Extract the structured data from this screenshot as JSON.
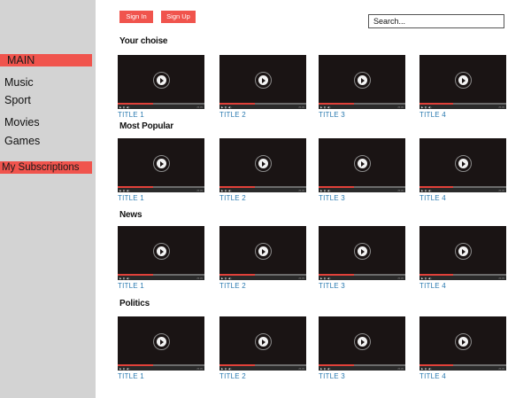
{
  "sidebar": {
    "main": "MAIN",
    "items": [
      "Music",
      "Sport",
      "Movies",
      "Games"
    ],
    "subscriptions": "My Subscriptions"
  },
  "header": {
    "sign_in": "Sign In",
    "sign_up": "Sign Up",
    "search_placeholder": "Search..."
  },
  "sections": [
    {
      "title": "Your choise",
      "videos": [
        "TITLE 1",
        "TITLE 2",
        "TITLE 3",
        "TITLE 4"
      ]
    },
    {
      "title": "Most Popular",
      "videos": [
        "TITLE 1",
        "TITLE 2",
        "TITLE 3",
        "TITLE 4"
      ]
    },
    {
      "title": "News",
      "videos": [
        "TITLE 1",
        "TITLE 2",
        "TITLE 3",
        "TITLE 4"
      ]
    },
    {
      "title": "Politics",
      "videos": [
        "TITLE 1",
        "TITLE 2",
        "TITLE 3",
        "TITLE 4"
      ]
    }
  ],
  "colors": {
    "accent": "#f0544d",
    "sidebar_bg": "#d3d3d3",
    "video_bg": "#1a1414",
    "title_link": "#2a7ab0"
  },
  "icons": {
    "video_overlay": "play-icon"
  }
}
